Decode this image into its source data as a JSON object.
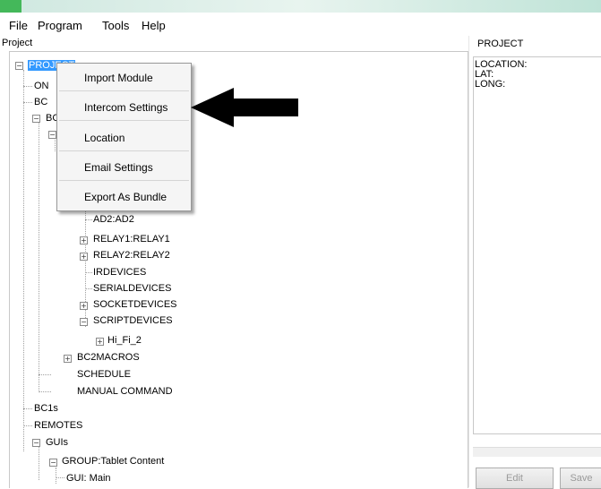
{
  "menu": {
    "file": "File",
    "program": "Program",
    "tools": "Tools",
    "help": "Help"
  },
  "panels": {
    "project_label": "Project",
    "properties_label": "PROJECT"
  },
  "properties": {
    "location": "LOCATION:",
    "lat": "LAT:",
    "long": "LONG:"
  },
  "tree": {
    "root": "PROJECT",
    "on": "ON",
    "bc1": "BC",
    "bc2": "BC",
    "ad2": "AD2:AD2",
    "relay1": "RELAY1:RELAY1",
    "relay2": "RELAY2:RELAY2",
    "irdevices": "IRDEVICES",
    "serialdevices": "SERIALDEVICES",
    "socketdevices": "SOCKETDEVICES",
    "scriptdevices": "SCRIPTDEVICES",
    "hifi": "Hi_Fi_2",
    "bc2macros": "BC2MACROS",
    "schedule": "SCHEDULE",
    "manual": "MANUAL COMMAND",
    "bc1s": "BC1s",
    "remotes": "REMOTES",
    "guis": "GUIs",
    "group": "GROUP:Tablet Content",
    "gui_main": "GUI: Main"
  },
  "context_menu": {
    "items": [
      "Import Module",
      "Intercom Settings",
      "Location",
      "Email Settings",
      "Export As Bundle"
    ]
  },
  "buttons": {
    "edit": "Edit",
    "save": "Save"
  },
  "icons": {
    "expand": "plus-box-icon",
    "collapse": "minus-box-icon",
    "pointer": "left-arrow-icon"
  },
  "colors": {
    "selection": "#3399ff",
    "title_green": "#44b85a"
  }
}
